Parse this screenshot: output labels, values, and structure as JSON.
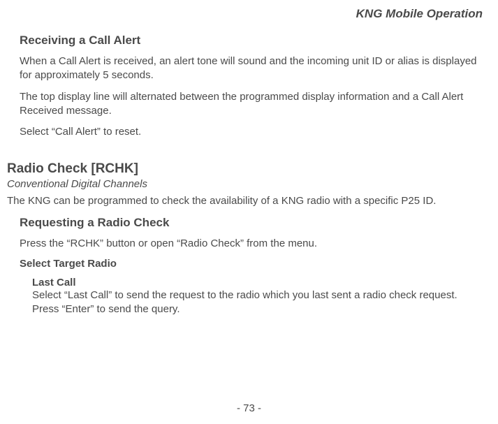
{
  "header": {
    "title": "KNG Mobile Operation"
  },
  "section1": {
    "heading": "Receiving a Call Alert",
    "para1": "When a Call Alert is received, an alert tone will sound and the incoming unit ID or alias is displayed for approximately 5 seconds.",
    "para2": "The top display line will alternated between the programmed display information and a Call Alert Received message.",
    "para3": "Select “Call Alert” to reset."
  },
  "section2": {
    "heading": "Radio Check [RCHK]",
    "subtitle": "Conventional Digital Channels",
    "intro": "The KNG can be programmed to check the availability of a KNG radio with a specific P25 ID.",
    "sub1": {
      "heading": "Requesting a Radio Check",
      "para1": "Press the “RCHK” button or open “Radio Check” from the menu.",
      "target_heading": "Select Target Radio",
      "lastcall": {
        "heading": "Last Call",
        "body": "Select “Last Call” to send the request to the radio which you last sent a radio check request. Press “Enter” to send the query."
      }
    }
  },
  "footer": {
    "page": "- 73 -"
  }
}
